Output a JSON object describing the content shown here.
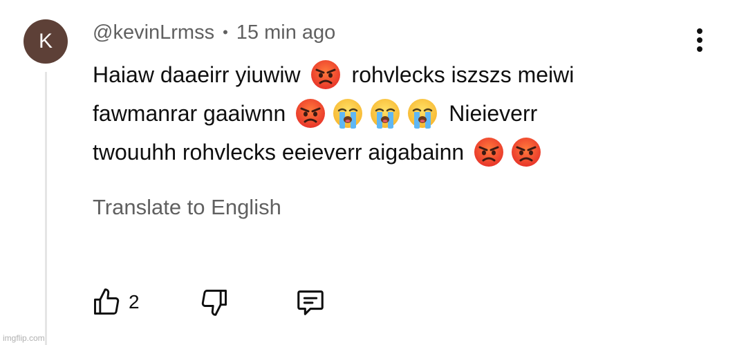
{
  "comment": {
    "avatar_letter": "K",
    "avatar_color": "#5d4037",
    "username": "@kevinLrmss",
    "separator": "•",
    "time": "15 min ago",
    "text_lines": [
      {
        "segments": [
          {
            "type": "text",
            "value": "Haiaw daaeirr yiuwiw"
          },
          {
            "type": "emoji",
            "value": "angry-face"
          },
          {
            "type": "text",
            "value": "rohvlecks iszszs meiwi"
          }
        ]
      },
      {
        "segments": [
          {
            "type": "text",
            "value": "fawmanrar gaaiwnn"
          },
          {
            "type": "emoji",
            "value": "angry-face"
          },
          {
            "type": "emoji",
            "value": "crying-face"
          },
          {
            "type": "emoji",
            "value": "crying-face"
          },
          {
            "type": "emoji",
            "value": "crying-face"
          },
          {
            "type": "text",
            "value": "Nieieverr"
          }
        ]
      },
      {
        "segments": [
          {
            "type": "text",
            "value": "twouuhh rohvlecks eeieverr aigabainn"
          },
          {
            "type": "emoji",
            "value": "angry-face"
          },
          {
            "type": "emoji",
            "value": "angry-face"
          }
        ]
      }
    ],
    "translate_label": "Translate to English",
    "like_count": "2",
    "icons": {
      "like": "thumbs-up-icon",
      "dislike": "thumbs-down-icon",
      "reply": "reply-icon",
      "more": "more-vertical-icon"
    }
  },
  "watermark": "imgflip.com"
}
